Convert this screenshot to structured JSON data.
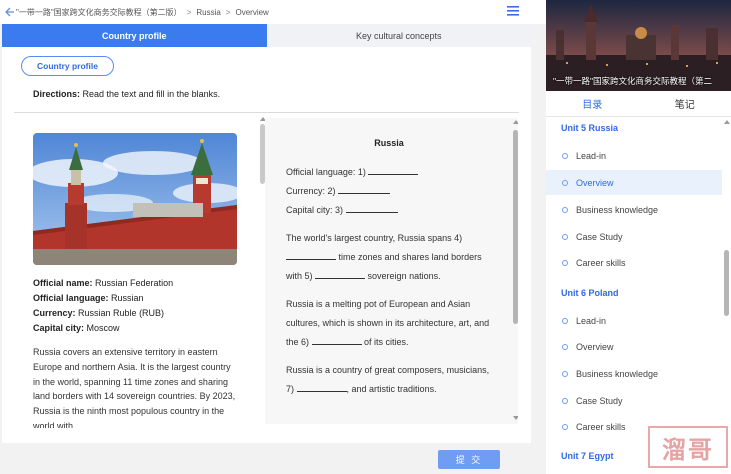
{
  "breadcrumb": {
    "course": "\"一带一路\"国家跨文化商务交际教程（第二版）",
    "unit": "Russia",
    "section": "Overview",
    "separator": ">"
  },
  "tabs": [
    {
      "label": "Country profile",
      "active": true
    },
    {
      "label": "Key cultural concepts",
      "active": false
    }
  ],
  "pill_label": "Country profile",
  "directions": {
    "label": "Directions:",
    "text": "Read the text and fill in the blanks."
  },
  "facts": [
    {
      "label": "Official name:",
      "value": "Russian Federation"
    },
    {
      "label": "Official language:",
      "value": "Russian"
    },
    {
      "label": "Currency:",
      "value": "Russian Ruble (RUB)"
    },
    {
      "label": "Capital city:",
      "value": "Moscow"
    }
  ],
  "paragraph": "Russia covers an extensive territory in eastern Europe and northern Asia. It is the largest country in the world, spanning 11 time zones and sharing land borders with 14 sovereign countries. By 2023, Russia is the ninth most populous country in the world with...",
  "exercise": {
    "title": "Russia",
    "l1a": "Official language: 1)",
    "l2a": "Currency: 2)",
    "l3a": "Capital city: 3)",
    "p1a": "The world's largest country, Russia spans 4)",
    "p1b": "time zones and shares land borders with 5)",
    "p1c": "sovereign nations.",
    "p2a": "Russia is a melting pot of European and Asian cultures, which is shown in its architecture, art, and the 6)",
    "p2b": "of its cities.",
    "p3a": "Russia is a country of great composers, musicians, 7)",
    "p3b": ", and artistic traditions."
  },
  "submit_label": "提 交",
  "sidebar": {
    "cover_title": "\"一带一路\"国家跨文化商务交际教程（第二",
    "tabs": [
      {
        "label": "目录",
        "active": true
      },
      {
        "label": "笔记",
        "active": false
      }
    ],
    "units": [
      {
        "title": "Unit 5 Russia",
        "items": [
          "Lead-in",
          "Overview",
          "Business knowledge",
          "Case Study",
          "Career skills"
        ],
        "selected": "Overview"
      },
      {
        "title": "Unit 6 Poland",
        "items": [
          "Lead-in",
          "Overview",
          "Business knowledge",
          "Case Study",
          "Career skills"
        ]
      },
      {
        "title": "Unit 7 Egypt",
        "items": []
      }
    ]
  },
  "watermark": "溜哥",
  "colors": {
    "accent": "#3a7bf0",
    "link": "#2f6ae6",
    "selected_bg": "#e9f1fd",
    "submit": "#6f9df3"
  }
}
